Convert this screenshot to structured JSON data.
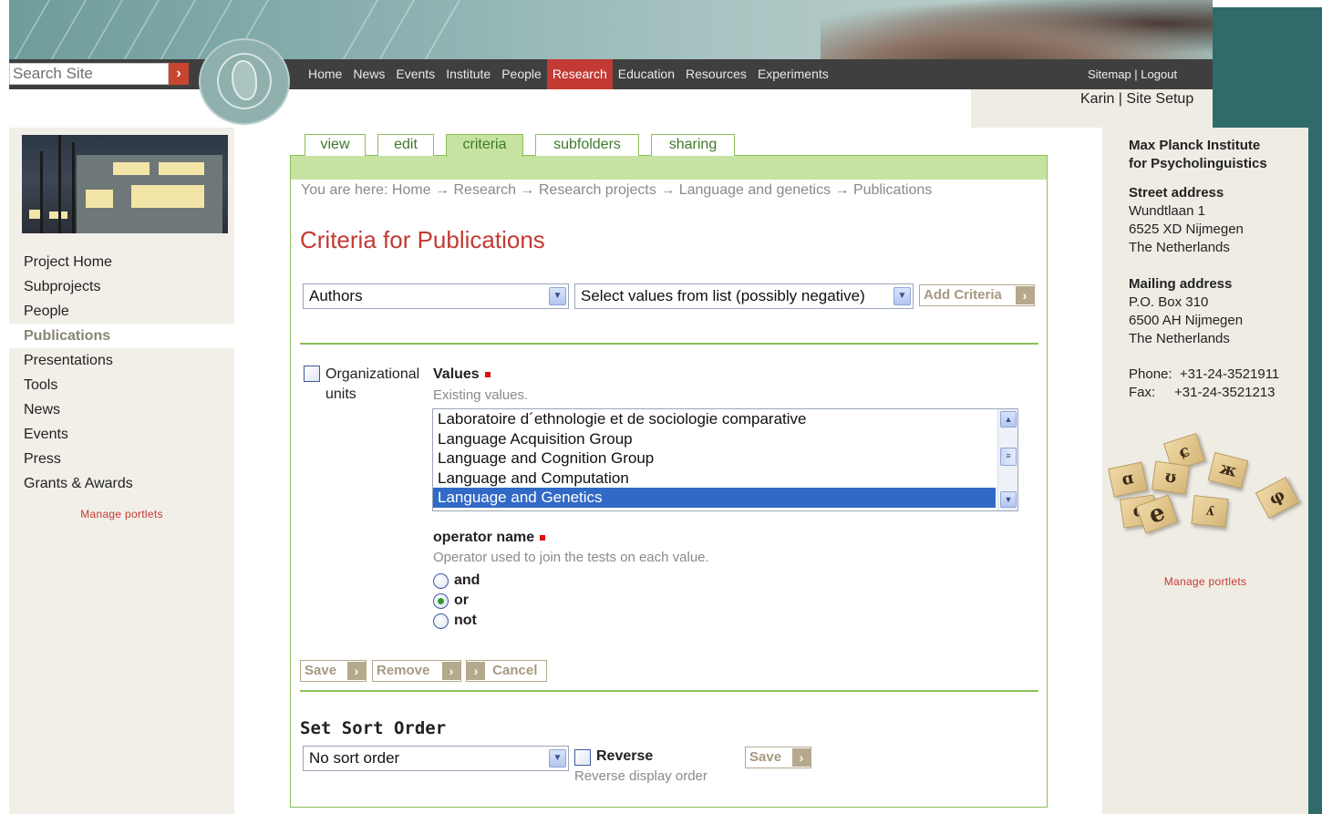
{
  "header": {
    "search_placeholder": "Search Site",
    "search_button_glyph": "›",
    "nav": [
      "Home",
      "News",
      "Events",
      "Institute",
      "People",
      "Research",
      "Education",
      "Resources",
      "Experiments"
    ],
    "active_nav": "Research",
    "user_links": "Sitemap | Logout",
    "account_links": "Karin | Site Setup"
  },
  "sidebar": {
    "items": [
      {
        "label": "Project Home"
      },
      {
        "label": "Subprojects"
      },
      {
        "label": "People"
      },
      {
        "label": "Publications"
      },
      {
        "label": "Presentations"
      },
      {
        "label": "Tools"
      },
      {
        "label": "News"
      },
      {
        "label": "Events"
      },
      {
        "label": "Press"
      },
      {
        "label": "Grants & Awards"
      }
    ],
    "active_item": "Publications",
    "manage_portlets": "Manage portlets"
  },
  "tabs": [
    {
      "label": "view"
    },
    {
      "label": "edit"
    },
    {
      "label": "criteria"
    },
    {
      "label": "subfolders"
    },
    {
      "label": "sharing"
    }
  ],
  "active_tab": "criteria",
  "main": {
    "breadcrumb": "You are here: Home → Research → Research projects → Language and genetics → Publications",
    "title": "Criteria for Publications",
    "criteria_index_select": "Authors",
    "criteria_type_select": "Select values from list (possibly negative)",
    "add_criteria_label": "Add Criteria",
    "criterion": {
      "field_name_line1": "Organizational",
      "field_name_line2": "units",
      "values_label": "Values",
      "values_help": "Existing values.",
      "values_options": [
        "Laboratoire d´ethnologie et de sociologie comparative",
        "Language Acquisition Group",
        "Language and Cognition Group",
        "Language and Computation",
        "Language and Genetics"
      ],
      "values_selected": "Language and Genetics",
      "operator_label": "operator name",
      "operator_help": "Operator used to join the tests on each value.",
      "operators": [
        "and",
        "or",
        "not"
      ],
      "operator_selected": "or"
    },
    "buttons": {
      "save": "Save",
      "remove": "Remove",
      "cancel": "Cancel"
    },
    "sort": {
      "title": "Set Sort Order",
      "select_value": "No sort order",
      "reverse_label": "Reverse",
      "reverse_help": "Reverse display order",
      "save": "Save"
    }
  },
  "right_portlet": {
    "org_line1": "Max Planck Institute",
    "org_line2": "for Psycholinguistics",
    "street_heading": "Street address",
    "street_lines": [
      "Wundtlaan 1",
      "6525 XD Nijmegen",
      "The Netherlands"
    ],
    "mailing_heading": "Mailing address",
    "mailing_lines": [
      "P.O. Box 310",
      "6500 AH Nijmegen",
      "The Netherlands"
    ],
    "phone": "Phone:  +31-24-3521911",
    "fax": "Fax:     +31-24-3521213",
    "manage_portlets": "Manage portlets"
  },
  "tile_glyphs": [
    "ɑ",
    "ɕ",
    "ж",
    "ʊ",
    "ɑ",
    "e",
    "ʎ",
    "φ"
  ],
  "colors": {
    "accent_red": "#c23a33",
    "green_border": "#8cbf58",
    "tab_green": "#c6e3a2",
    "teal": "#2f6b6b",
    "select_highlight": "#3169c6"
  }
}
